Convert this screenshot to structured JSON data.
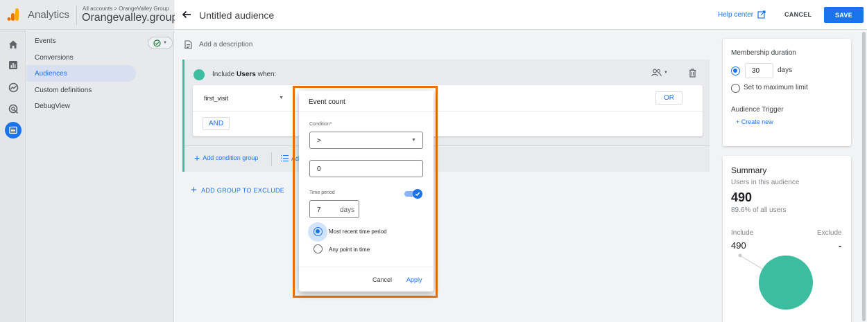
{
  "app": {
    "name": "Analytics",
    "breadcrumb": "All accounts > OrangeValley Group",
    "property": "Orangevalley.group"
  },
  "rail": {
    "icons": [
      "home-icon",
      "reports-icon",
      "explore-icon",
      "advertising-icon",
      "configure-icon"
    ],
    "active": "configure-icon"
  },
  "sidebar": {
    "items": [
      {
        "label": "Events"
      },
      {
        "label": "Conversions"
      },
      {
        "label": "Audiences"
      },
      {
        "label": "Custom definitions"
      },
      {
        "label": "DebugView"
      }
    ],
    "active_index": 2
  },
  "header": {
    "title": "Untitled audience",
    "help_label": "Help center",
    "cancel_label": "CANCEL",
    "save_label": "SAVE"
  },
  "builder": {
    "description_placeholder": "Add a description",
    "include_prefix": "Include ",
    "include_subject": "Users",
    "include_suffix": " when:",
    "condition_event": "first_visit",
    "or_label": "OR",
    "and_label": "AND",
    "add_condition_group": "Add condition group",
    "add_sequence_partial": "Ad",
    "add_group_exclude": "ADD GROUP TO EXCLUDE"
  },
  "dialog": {
    "title": "Event count",
    "condition_label": "Condition*",
    "condition_value": ">",
    "count_value": "0",
    "time_period_label": "Time period",
    "time_period_enabled": true,
    "period_value": "7",
    "period_unit": "days",
    "options": [
      "Most recent time period",
      "Any point in time"
    ],
    "selected_option": 0,
    "cancel_label": "Cancel",
    "apply_label": "Apply"
  },
  "membership": {
    "title": "Membership duration",
    "days_value": "30",
    "days_unit": "days",
    "max_limit_label": "Set to maximum limit",
    "selected": "days",
    "trigger_title": "Audience Trigger",
    "create_new_label": "+ Create new"
  },
  "summary": {
    "title": "Summary",
    "users_label": "Users in this audience",
    "users_count": "490",
    "users_pct": "89.6% of all users",
    "include_label": "Include",
    "include_value": "490",
    "exclude_label": "Exclude",
    "exclude_value": "-"
  },
  "colors": {
    "accent": "#1a73e8",
    "teal": "#3dbda0",
    "highlight": "#e8710a",
    "logo_orange": "#f9ab00",
    "logo_dark": "#e37400"
  }
}
